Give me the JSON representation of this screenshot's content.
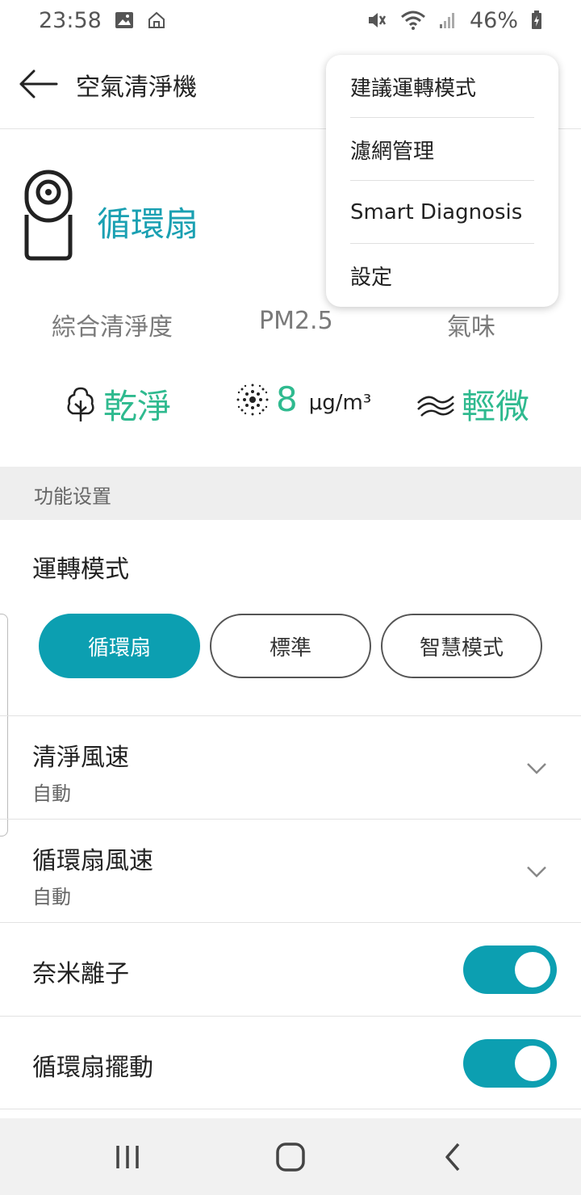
{
  "status_bar": {
    "time": "23:58",
    "battery": "46%",
    "icons": [
      "image-icon",
      "home-outline-icon",
      "mute-icon",
      "wifi-icon",
      "signal-icon",
      "battery-icon"
    ]
  },
  "header": {
    "title": "空氣清淨機",
    "back_icon": "arrow-left-icon"
  },
  "device": {
    "icon": "air-purifier-icon",
    "mode_name": "循環扇"
  },
  "metrics": {
    "labels": [
      "綜合清淨度",
      "PM2.5",
      "氣味"
    ],
    "overall": {
      "icon": "tree-icon",
      "value": "乾淨"
    },
    "pm25": {
      "icon": "particles-icon",
      "value": "8",
      "unit": "μg/m³"
    },
    "odor": {
      "icon": "waves-icon",
      "value": "輕微"
    }
  },
  "section": {
    "title": "功能设置"
  },
  "mode": {
    "heading": "運轉模式",
    "buttons": [
      {
        "label": "循環扇",
        "active": true
      },
      {
        "label": "標準",
        "active": false
      },
      {
        "label": "智慧模式",
        "active": false
      }
    ]
  },
  "settings": {
    "clean_speed": {
      "label": "清淨風速",
      "value": "自動"
    },
    "fan_speed": {
      "label": "循環扇風速",
      "value": "自動"
    },
    "nano_ion": {
      "label": "奈米離子",
      "enabled": true
    },
    "fan_swing": {
      "label": "循環扇擺動",
      "enabled": true
    }
  },
  "menu": {
    "items": [
      "建議運轉模式",
      "濾網管理",
      "Smart Diagnosis",
      "設定"
    ]
  },
  "colors": {
    "accent": "#0c9fb1",
    "value_green": "#2fba8f",
    "section_bg": "#eeeeee"
  }
}
